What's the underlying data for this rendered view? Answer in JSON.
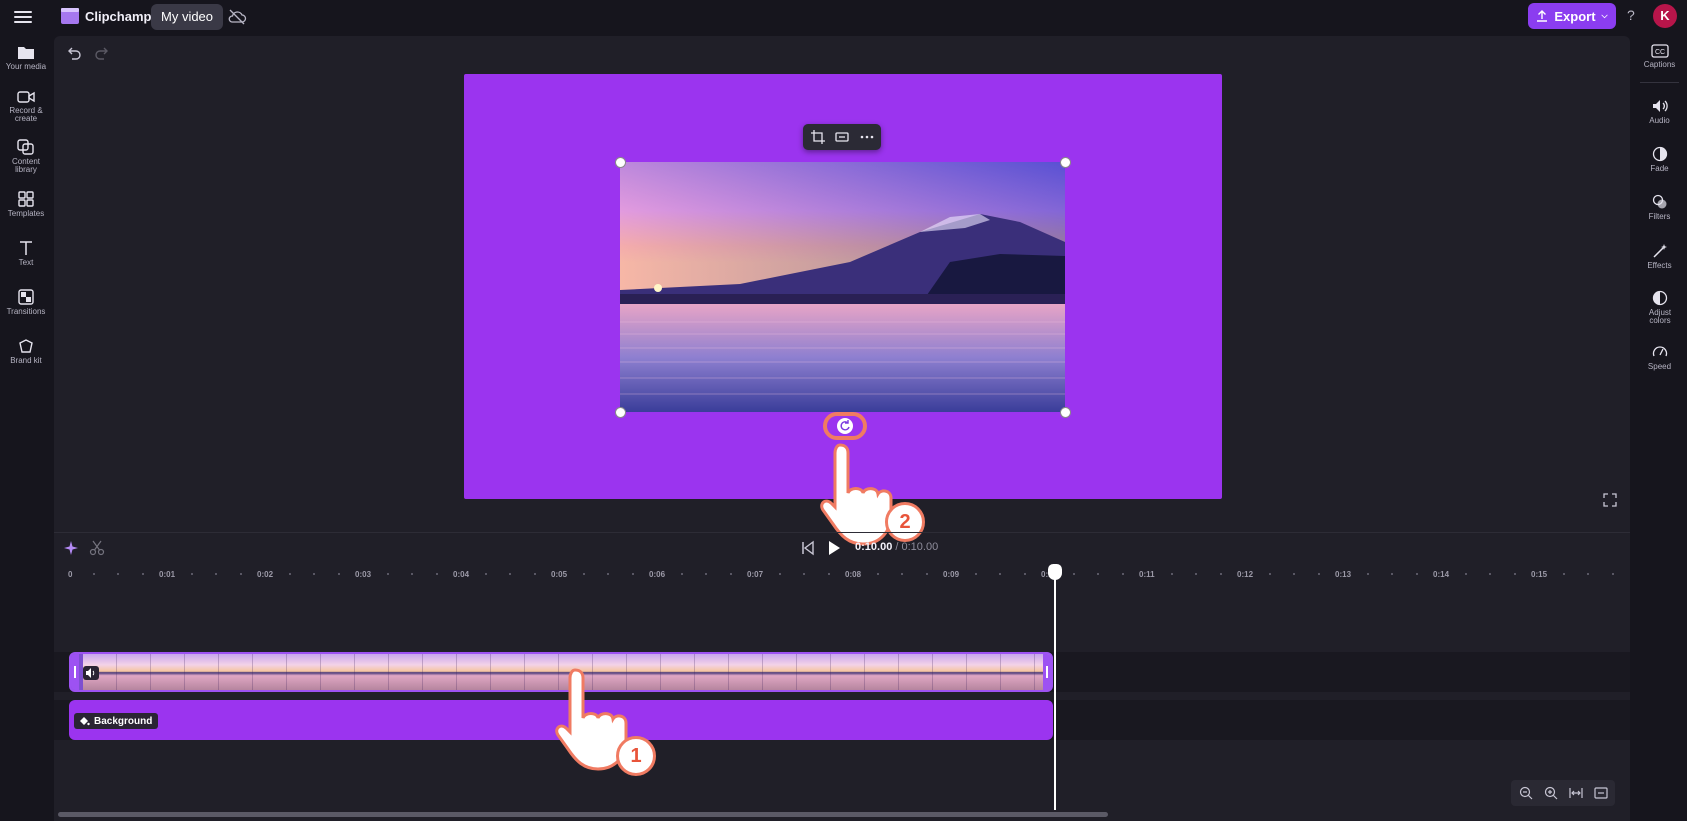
{
  "app": {
    "name": "Clipchamp",
    "project_title": "My video"
  },
  "header": {
    "export_label": "Export",
    "help_label": "?",
    "avatar_initial": "K"
  },
  "left_sidebar": {
    "items": [
      {
        "id": "your-media",
        "label": "Your media"
      },
      {
        "id": "record-create",
        "label": "Record & create"
      },
      {
        "id": "content-library",
        "label": "Content library"
      },
      {
        "id": "templates",
        "label": "Templates"
      },
      {
        "id": "text",
        "label": "Text"
      },
      {
        "id": "transitions",
        "label": "Transitions"
      },
      {
        "id": "brand-kit",
        "label": "Brand kit"
      }
    ]
  },
  "right_sidebar": {
    "items": [
      {
        "id": "captions",
        "label": "Captions"
      },
      {
        "id": "audio",
        "label": "Audio"
      },
      {
        "id": "fade",
        "label": "Fade"
      },
      {
        "id": "filters",
        "label": "Filters"
      },
      {
        "id": "effects",
        "label": "Effects"
      },
      {
        "id": "adjust-colors",
        "label": "Adjust colors"
      },
      {
        "id": "speed",
        "label": "Speed"
      }
    ]
  },
  "preview": {
    "canvas_color": "#9b34ef"
  },
  "playback": {
    "current_time": "0:10.00",
    "duration": "/ 0:10.00"
  },
  "timeline": {
    "ruler": [
      "0",
      "0:01",
      "0:02",
      "0:03",
      "0:04",
      "0:05",
      "0:06",
      "0:07",
      "0:08",
      "0:09",
      "0:10",
      "0:11",
      "0:12",
      "0:13",
      "0:14",
      "0:15"
    ],
    "background_clip_label": "Background"
  },
  "annotations": {
    "step1": "1",
    "step2": "2",
    "highlight_color": "#f07b62"
  },
  "colors": {
    "accent": "#8b3df0",
    "background": "#16151d",
    "workspace": "#201f28"
  }
}
